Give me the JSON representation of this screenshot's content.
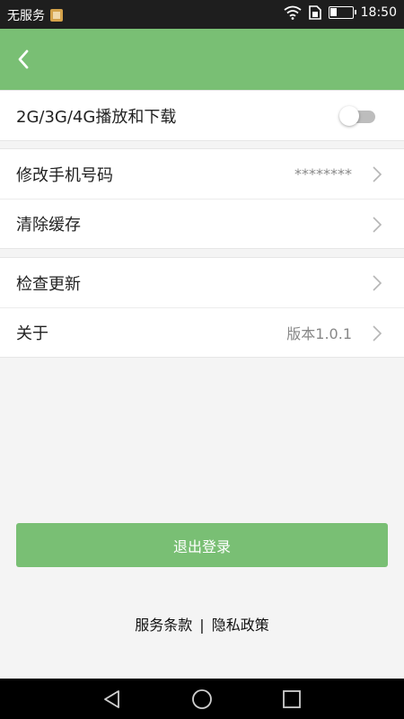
{
  "status_bar": {
    "carrier": "无服务",
    "time": "18:50",
    "battery_level": 0.3,
    "icons": [
      "sim-card-icon",
      "wifi-icon",
      "data-sim-icon",
      "battery-icon"
    ]
  },
  "app_bar": {
    "back_icon": "chevron-left-icon"
  },
  "settings": {
    "network_playback": {
      "label": "2G/3G/4G播放和下载",
      "enabled": false
    },
    "change_phone": {
      "label": "修改手机号码",
      "value": "********"
    },
    "clear_cache": {
      "label": "清除缓存"
    },
    "check_update": {
      "label": "检查更新"
    },
    "about": {
      "label": "关于",
      "value": "版本1.0.1"
    }
  },
  "logout": {
    "label": "退出登录"
  },
  "footer": {
    "terms": "服务条款",
    "separator": "|",
    "privacy": "隐私政策"
  },
  "nav_bar": {
    "icons": [
      "back-triangle-icon",
      "home-circle-icon",
      "recents-square-icon"
    ]
  },
  "colors": {
    "accent": "#79bf74",
    "status_bar": "#1e1e1e",
    "background": "#f4f4f4",
    "text": "#222222",
    "secondary_text": "#888888",
    "toggle_off": "#bdbdbd"
  }
}
